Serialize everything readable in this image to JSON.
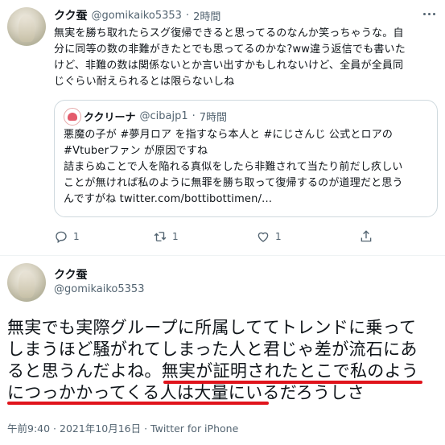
{
  "tweet1": {
    "display_name": "クク蚕",
    "handle": "@gomikaiko5353",
    "sep": "·",
    "time": "2時間",
    "more_icon": "more-horizontal-icon",
    "lines": [
      "無実を勝ち取れたらスグ復帰できると思ってるのなんか笑っちゃうな。自",
      "分に同等の数の非難がきたとでも思ってるのかな?ww違う返信でも書いた",
      "けど、非難の数は関係ないとか言い出すかもしれないけど、全員が全員同",
      "じぐらい耐えられるとは限らないしね"
    ],
    "quote": {
      "display_name": "ククリーナ",
      "handle": "@cibajp1",
      "sep": "·",
      "time": "7時間",
      "lines": [
        "悪魔の子が #夢月ロア を指すなら本人と #にじさんじ 公式とロアの",
        "#Vtuberファン が原因ですね",
        "詰まらぬことで人を陥れる真似をしたら非難されて当たり前だし疚しい",
        "ことが無ければ私のように無罪を勝ち取って復帰するのが道理だと思う",
        "んですがね twitter.com/bottibottimen/..."
      ]
    },
    "actions": {
      "reply_count": "1",
      "retweet_count": "1",
      "like_count": "1",
      "reply_icon": "reply-icon",
      "retweet_icon": "retweet-icon",
      "like_icon": "heart-icon",
      "share_icon": "share-icon"
    }
  },
  "tweet2": {
    "display_name": "クク蚕",
    "handle": "@gomikaiko5353",
    "lines": [
      "無実でも実際グループに所属しててトレンドに乗って",
      "しまうほど騒がれてしまった人と君じゃ差が流石にあ",
      "ると思うんだよね。無実が証明されたとこで私のよう",
      "につっかかってくる人は大量にいるだろうしさ"
    ],
    "timestamp": "午前9:40 · 2021年10月16日 · Twitter for iPhone"
  },
  "colors": {
    "text": "#0f1419",
    "muted": "#536471",
    "border": "#cfd9de",
    "annotation_underline": "#e0141c"
  }
}
